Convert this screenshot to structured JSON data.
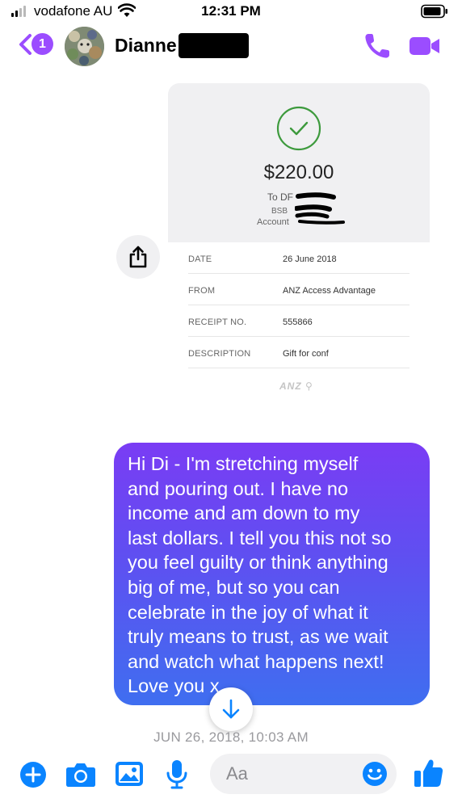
{
  "status_bar": {
    "carrier": "vodafone AU",
    "time": "12:31 PM"
  },
  "header": {
    "back_badge_count": "1",
    "contact_name": "Dianne",
    "icons": [
      "back-chevron-icon",
      "avatar",
      "phone-icon",
      "video-camera-icon"
    ]
  },
  "receipt": {
    "amount": "$220.00",
    "to_label": "To DF",
    "bsb_label": "BSB",
    "account_label": "Account",
    "rows": [
      {
        "label": "DATE",
        "value": "26 June 2018"
      },
      {
        "label": "FROM",
        "value": "ANZ Access Advantage"
      },
      {
        "label": "RECEIPT NO.",
        "value": "555866"
      },
      {
        "label": "DESCRIPTION",
        "value": "Gift for conf"
      }
    ],
    "logo_text": "ANZ"
  },
  "message": {
    "text": "Hi Di - I'm stretching myself\nand pouring out. I have no\nincome and am down to my\nlast dollars. I tell you this not so\nyou feel guilty or think anything\nbig of me, but so you can\ncelebrate in the joy of what it\ntruly means to trust, as we wait\nand watch what happens next!\nLove you x"
  },
  "timestamp": "JUN 26, 2018, 10:03 AM",
  "composer": {
    "placeholder": "Aa",
    "icons": [
      "plus-icon",
      "camera-icon",
      "image-icon",
      "microphone-icon",
      "emoji-icon",
      "thumbs-up-icon"
    ]
  },
  "colors": {
    "accent": "#9b4dff",
    "bubble_top": "#7a3cf4",
    "bubble_bottom": "#3f6ef0",
    "composer_blue": "#0a84ff",
    "check_green": "#3d9a3d"
  }
}
